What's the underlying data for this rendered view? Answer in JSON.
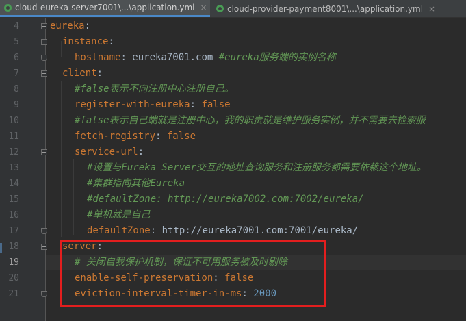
{
  "tabs": [
    {
      "label": "cloud-eureka-server7001\\...\\application.yml",
      "close": "×",
      "active": true,
      "icon": "yml-file-icon"
    },
    {
      "label": "cloud-provider-payment8001\\...\\application.yml",
      "close": "×",
      "active": false,
      "icon": "yml-file-icon"
    }
  ],
  "editor": {
    "current_line": 19,
    "lines": [
      {
        "n": "4",
        "k": "eureka",
        "s": ":",
        "v": "",
        "c": ""
      },
      {
        "n": "5",
        "k": "instance",
        "s": ":",
        "v": "",
        "c": ""
      },
      {
        "n": "6",
        "k": "hostname",
        "s": ": ",
        "v": "eureka7001.com ",
        "c": "#eureka服务端的实例名称"
      },
      {
        "n": "7",
        "k": "client",
        "s": ":",
        "v": "",
        "c": ""
      },
      {
        "n": "8",
        "k": "",
        "s": "",
        "v": "",
        "c": "#false表示不向注册中心注册自己。"
      },
      {
        "n": "9",
        "k": "register-with-eureka",
        "s": ": ",
        "v": "false",
        "c": ""
      },
      {
        "n": "10",
        "k": "",
        "s": "",
        "v": "",
        "c": "#false表示自己端就是注册中心，我的职责就是维护服务实例，并不需要去检索服"
      },
      {
        "n": "11",
        "k": "fetch-registry",
        "s": ": ",
        "v": "false",
        "c": ""
      },
      {
        "n": "12",
        "k": "service-url",
        "s": ":",
        "v": "",
        "c": ""
      },
      {
        "n": "13",
        "k": "",
        "s": "",
        "v": "",
        "c": "#设置与Eureka Server交互的地址查询服务和注册服务都需要依赖这个地址。"
      },
      {
        "n": "14",
        "k": "",
        "s": "",
        "v": "",
        "c": "#集群指向其他Eureka"
      },
      {
        "n": "15",
        "k": "",
        "s": "",
        "v": "",
        "c": "#defaultZone: ",
        "link": "http://eureka7002.com:7002/eureka/"
      },
      {
        "n": "16",
        "k": "",
        "s": "",
        "v": "",
        "c": "#单机就是自己"
      },
      {
        "n": "17",
        "k": "defaultZone",
        "s": ": ",
        "v": "http://eureka7001.com:7001/eureka/",
        "c": ""
      },
      {
        "n": "18",
        "k": "server",
        "s": ":",
        "v": "",
        "c": ""
      },
      {
        "n": "19",
        "k": "",
        "s": "",
        "v": "",
        "c": "# 关闭自我保护机制，保证不可用服务被及时剔除"
      },
      {
        "n": "20",
        "k": "enable-self-preservation",
        "s": ": ",
        "v": "false",
        "c": ""
      },
      {
        "n": "21",
        "k": "eviction-interval-timer-in-ms",
        "s": ": ",
        "v": "2000",
        "c": "",
        "numeric": true
      }
    ]
  },
  "colors": {
    "background": "#2B2B2B",
    "key": "#CC7832",
    "comment": "#629755",
    "number": "#6897BB",
    "text": "#A9B7C6",
    "highlight_box": "#E31E1E"
  }
}
